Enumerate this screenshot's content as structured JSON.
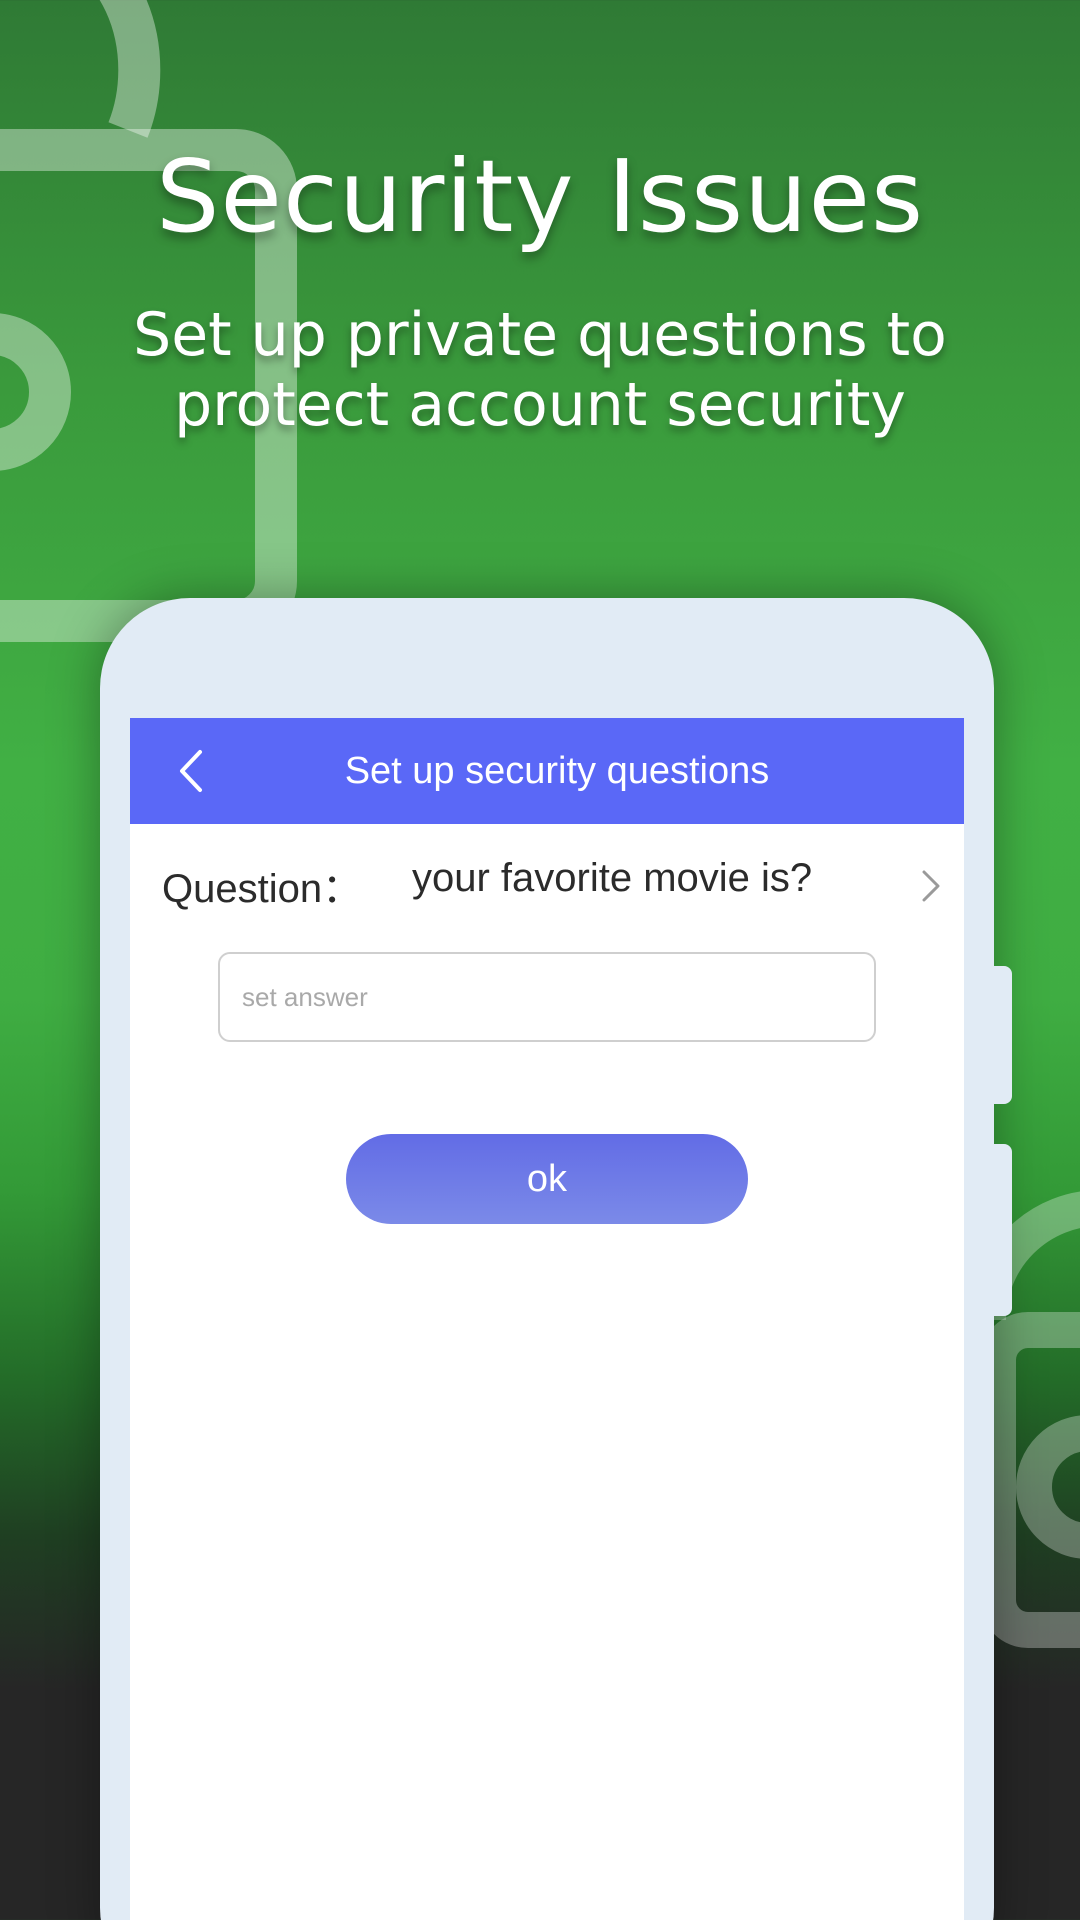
{
  "promo": {
    "headline": "Security Issues",
    "subline": "Set up private questions to protect account security"
  },
  "app": {
    "header": {
      "title": "Set up security questions",
      "back_icon": "chevron-left-icon",
      "background_color": "#5a68f7"
    },
    "question": {
      "label": "Question：",
      "value": "your favorite movie is?",
      "chevron_icon": "chevron-right-icon"
    },
    "answer_input": {
      "value": "",
      "placeholder": "set answer"
    },
    "ok_button": {
      "label": "ok",
      "color": "#6a76e8"
    }
  },
  "colors": {
    "background_green": "#41b044",
    "background_dark": "#262626",
    "phone_frame": "#e1ebf5"
  }
}
